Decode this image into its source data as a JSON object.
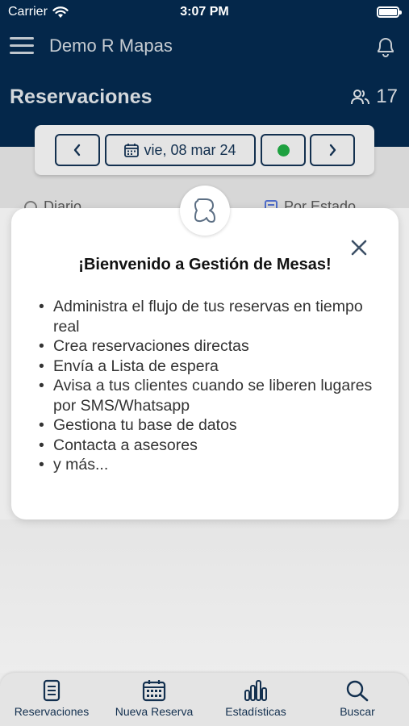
{
  "status_bar": {
    "carrier": "Carrier",
    "time": "3:07 PM"
  },
  "header": {
    "app_title": "Demo R Mapas",
    "page_title": "Reservaciones",
    "guest_count": "17"
  },
  "date_bar": {
    "date_label": "vie, 08 mar 24",
    "status_color": "#1ea140"
  },
  "background_peek": {
    "left_option": "Diario",
    "right_option": "Por Estado"
  },
  "modal": {
    "title": "¡Bienvenido a Gestión de Mesas!",
    "features": [
      " Administra el flujo de tus reservas en tiempo real",
      " Crea reservaciones directas",
      " Envía a Lista de espera",
      " Avisa a tus clientes cuando se liberen lugares por SMS/Whatsapp",
      " Gestiona tu base de datos",
      " Contacta a asesores",
      " y más..."
    ]
  },
  "tab_bar": [
    {
      "label": "Reservaciones",
      "icon": "document-icon"
    },
    {
      "label": "Nueva Reserva",
      "icon": "calendar-icon"
    },
    {
      "label": "Estadísticas",
      "icon": "bar-chart-icon"
    },
    {
      "label": "Buscar",
      "icon": "search-icon"
    }
  ],
  "colors": {
    "header_bg": "#04274a",
    "accent": "#13304f",
    "status_green": "#1ea140"
  }
}
